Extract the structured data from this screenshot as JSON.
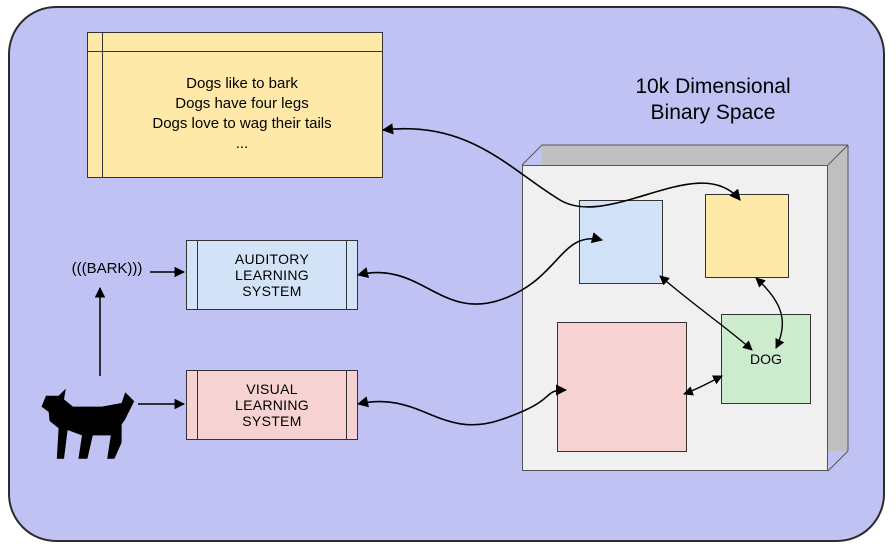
{
  "doc": {
    "line1": "Dogs like to bark",
    "line2": "Dogs have four legs",
    "line3": "Dogs love to wag their tails",
    "line4": "..."
  },
  "bark_label": "(((BARK)))",
  "systems": {
    "auditory": "AUDITORY\nLEARNING\nSYSTEM",
    "visual": "VISUAL\nLEARNING\nSYSTEM"
  },
  "space": {
    "title_line1": "10k Dimensional",
    "title_line2": "Binary Space",
    "dog_label": "DOG"
  },
  "colors": {
    "panel_bg": "#c0c2f4",
    "doc_bg": "#ffe9a8",
    "aud_bg": "#d3e3f7",
    "vis_bg": "#f6d2d2",
    "green_bg": "#cdeccd",
    "cube_front": "#f0f0f0",
    "cube_back": "#bfbfbf"
  }
}
